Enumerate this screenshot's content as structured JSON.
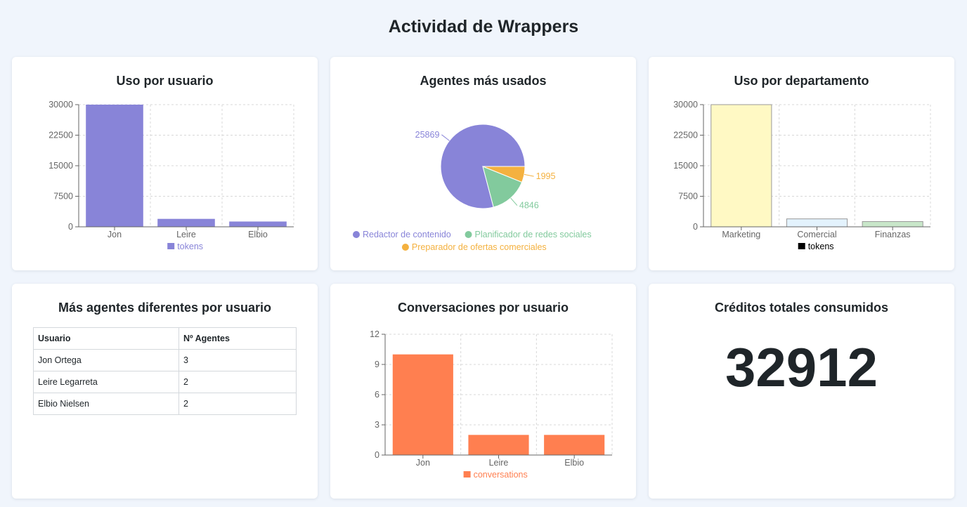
{
  "page": {
    "title": "Actividad de Wrappers"
  },
  "cards": {
    "usage_by_user": {
      "title": "Uso por usuario"
    },
    "top_agents": {
      "title": "Agentes más usados"
    },
    "usage_by_department": {
      "title": "Uso por departamento"
    },
    "distinct_agents": {
      "title": "Más agentes diferentes por usuario",
      "columns": [
        "Usuario",
        "Nº Agentes"
      ],
      "rows": [
        [
          "Jon Ortega",
          "3"
        ],
        [
          "Leire Legarreta",
          "2"
        ],
        [
          "Elbio Nielsen",
          "2"
        ]
      ]
    },
    "conversations_by_user": {
      "title": "Conversaciones por usuario"
    },
    "total_credits": {
      "title": "Créditos totales consumidos",
      "value": "32912"
    }
  },
  "chart_data": [
    {
      "id": "usage_by_user",
      "type": "bar",
      "title": "Uso por usuario",
      "categories": [
        "Jon",
        "Leire",
        "Elbio"
      ],
      "series": [
        {
          "name": "tokens",
          "values": [
            30000,
            1950,
            1300
          ],
          "color": "#8884d8"
        }
      ],
      "ylim": [
        0,
        30000
      ],
      "yticks": [
        0,
        7500,
        15000,
        22500,
        30000
      ],
      "grid": true,
      "legend": "bottom"
    },
    {
      "id": "top_agents",
      "type": "pie",
      "title": "Agentes más usados",
      "slices": [
        {
          "label": "Redactor de contenido",
          "value": 25869,
          "color": "#8884d8"
        },
        {
          "label": "Planificador de redes sociales",
          "value": 4846,
          "color": "#82ca9d"
        },
        {
          "label": "Preparador de ofertas comerciales",
          "value": 1995,
          "color": "#f4b13f"
        }
      ],
      "legend": "bottom"
    },
    {
      "id": "usage_by_department",
      "type": "bar",
      "title": "Uso por departamento",
      "categories": [
        "Marketing",
        "Comercial",
        "Finanzas"
      ],
      "series": [
        {
          "name": "tokens",
          "values": [
            30000,
            1950,
            1300
          ],
          "colors": [
            "#fff9c4",
            "#e3f2fd",
            "#c8e6c9"
          ],
          "stroke": "#999999"
        }
      ],
      "ylim": [
        0,
        30000
      ],
      "yticks": [
        0,
        7500,
        15000,
        22500,
        30000
      ],
      "grid": true,
      "legend": "bottom",
      "legend_color": "#000000"
    },
    {
      "id": "conversations_by_user",
      "type": "bar",
      "title": "Conversaciones por usuario",
      "categories": [
        "Jon",
        "Leire",
        "Elbio"
      ],
      "series": [
        {
          "name": "conversations",
          "values": [
            10,
            2,
            2
          ],
          "color": "#ff7f50"
        }
      ],
      "ylim": [
        0,
        12
      ],
      "yticks": [
        0,
        3,
        6,
        9,
        12
      ],
      "grid": true,
      "legend": "bottom"
    }
  ]
}
